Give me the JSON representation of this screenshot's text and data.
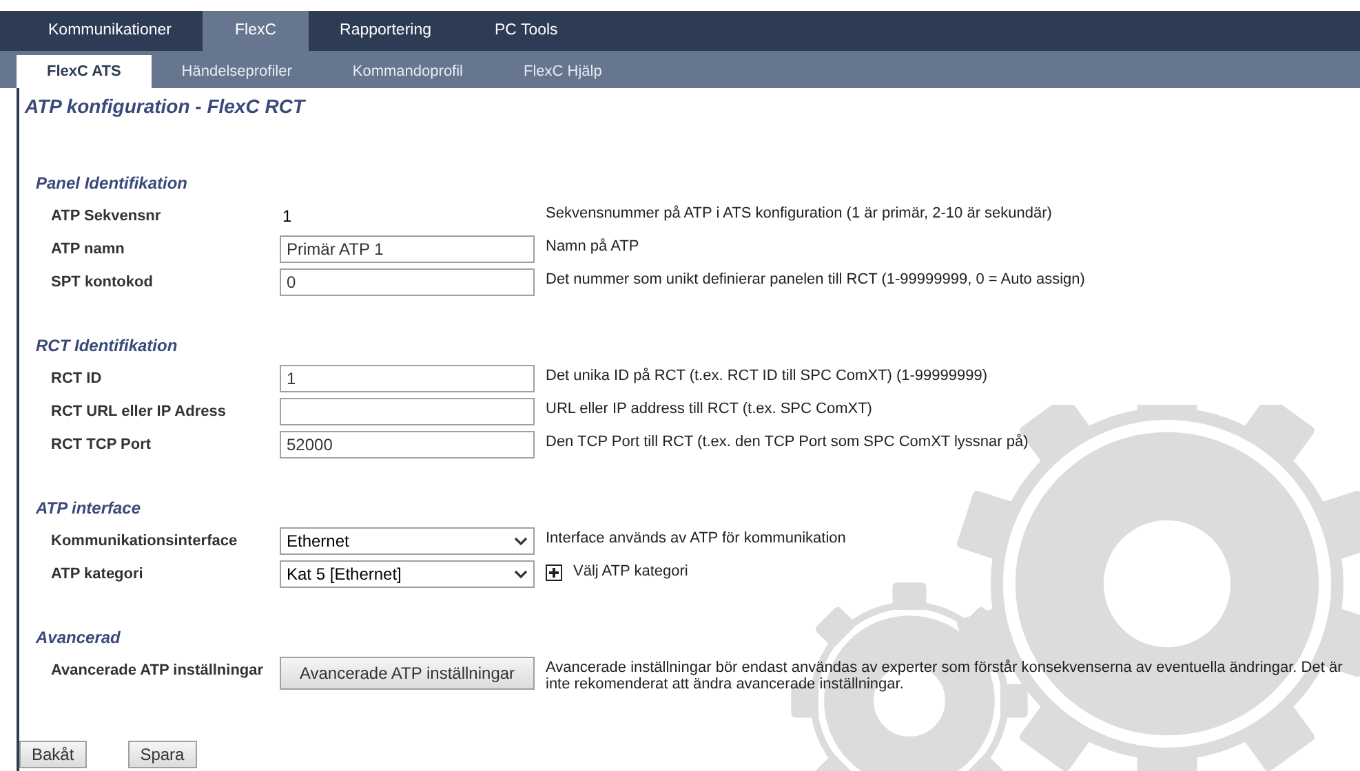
{
  "top_tabs": [
    {
      "label": "Kommunikationer",
      "selected": false
    },
    {
      "label": "FlexC",
      "selected": true
    },
    {
      "label": "Rapportering",
      "selected": false
    },
    {
      "label": "PC Tools",
      "selected": false
    }
  ],
  "sub_tabs": [
    {
      "label": "FlexC ATS",
      "selected": true
    },
    {
      "label": "Händelseprofiler",
      "selected": false
    },
    {
      "label": "Kommandoprofil",
      "selected": false
    },
    {
      "label": "FlexC Hjälp",
      "selected": false
    }
  ],
  "page_title": "ATP konfiguration - FlexC RCT",
  "sections": [
    {
      "title": "Panel Identifikation",
      "rows": [
        {
          "kind": "text",
          "label": "ATP Sekvensnr",
          "value": "1",
          "description": "Sekvensnummer på ATP i ATS konfiguration (1 är primär, 2-10 är sekundär)"
        },
        {
          "kind": "input",
          "label": "ATP namn",
          "value": "Primär ATP 1",
          "description": "Namn på ATP"
        },
        {
          "kind": "input",
          "label": "SPT kontokod",
          "value": "0",
          "description": "Det nummer som unikt definierar panelen till RCT (1-99999999, 0 = Auto assign)"
        }
      ]
    },
    {
      "title": "RCT Identifikation",
      "rows": [
        {
          "kind": "input",
          "label": "RCT ID",
          "value": "1",
          "description": "Det unika ID på RCT (t.ex. RCT ID till SPC ComXT) (1-99999999)"
        },
        {
          "kind": "input",
          "label": "RCT URL eller IP Adress",
          "value": "",
          "description": "URL eller IP address till RCT (t.ex. SPC ComXT)"
        },
        {
          "kind": "input",
          "label": "RCT TCP Port",
          "value": "52000",
          "description": "Den TCP Port till RCT (t.ex. den TCP Port som SPC ComXT lyssnar på)"
        }
      ]
    },
    {
      "title": "ATP interface",
      "rows": [
        {
          "kind": "select",
          "label": "Kommunikationsinterface",
          "value": "Ethernet",
          "description": "Interface används av ATP för kommunikation",
          "expandable": false
        },
        {
          "kind": "select",
          "label": "ATP kategori",
          "value": "Kat 5 [Ethernet]",
          "description": "Välj ATP kategori",
          "expandable": true
        }
      ]
    },
    {
      "title": "Avancerad",
      "rows": [
        {
          "kind": "button",
          "label": "Avancerade ATP inställningar",
          "value": "Avancerade ATP inställningar",
          "description": "Avancerade inställningar bör endast användas av experter som förstår konsekvenserna av eventuella ändringar. Det är inte rekomenderat att ändra avancerade inställningar."
        }
      ]
    }
  ],
  "footer_buttons": [
    "Bakåt",
    "Spara"
  ]
}
